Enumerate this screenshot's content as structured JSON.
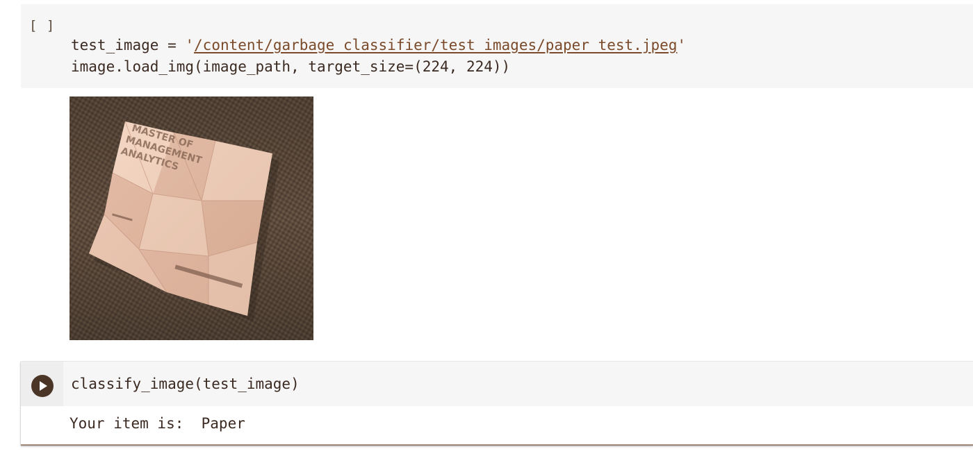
{
  "cell1": {
    "exec_count": "[ ]",
    "line1_prefix": "test_image = ",
    "line1_quote_open": "'",
    "line1_path": "/content/garbage_classifier/test_images/paper_test.jpeg",
    "line1_quote_close": "'",
    "line2_prefix": "image.load_img(image_path, target_size=(",
    "line2_num1": "224",
    "line2_sep": ", ",
    "line2_num2": "224",
    "line2_suffix": "))"
  },
  "image_output": {
    "printed_text": [
      "MASTER OF",
      "MANAGEMENT",
      "ANALYTICS"
    ],
    "colors": {
      "carpet": "#5c4a3c",
      "paper": "#e6c2ae"
    }
  },
  "cell2": {
    "run_icon": "play-icon",
    "code": "classify_image(test_image)",
    "output": "Your item is:  Paper"
  }
}
